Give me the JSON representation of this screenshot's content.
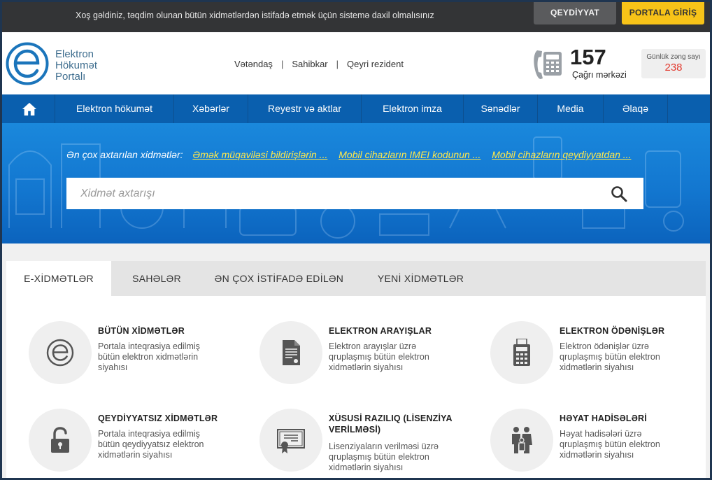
{
  "topbar": {
    "message": "Xoş gəldiniz, təqdim olunan bütün xidmətlərdən istifadə etmək üçün sistemə daxil olmalısınız",
    "register_label": "QEYDİYYAT",
    "login_label": "PORTALA GİRİŞ"
  },
  "logo": {
    "line1": "Elektron",
    "line2": "Hökumət",
    "line3": "Portalı"
  },
  "user_nav": [
    "Vətəndaş",
    "Sahibkar",
    "Qeyri rezident"
  ],
  "call_center": {
    "number": "157",
    "label": "Çağrı mərkəzi",
    "daily_label": "Günlük zəng sayı",
    "daily_value": "238"
  },
  "main_nav": [
    "Elektron hökumət",
    "Xəbərlər",
    "Reyestr və aktlar",
    "Elektron imza",
    "Sənədlər",
    "Media",
    "Əlaqə"
  ],
  "hero": {
    "popular_label": "Ən çox axtarılan xidmətlər:",
    "popular_links": [
      "Əmək müqaviləsi bildirişlərin ...",
      "Mobil cihazların IMEI kodunun ...",
      "Mobil cihazların qeydiyyatdan ..."
    ],
    "search_placeholder": "Xidmət axtarışı"
  },
  "tabs": [
    "E-XİDMƏTLƏR",
    "SAHƏLƏR",
    "ƏN ÇOX İSTİFADƏ EDİLƏN",
    "YENİ XİDMƏTLƏR"
  ],
  "services": [
    {
      "title": "BÜTÜN XİDMƏTLƏR",
      "desc": "Portala inteqrasiya edilmiş bütün elektron xidmətlərin siyahısı",
      "icon": "egov-logo-icon"
    },
    {
      "title": "ELEKTRON ARAYIŞLAR",
      "desc": "Elektron arayışlar üzrə qruplaşmış bütün elektron xidmətlərin siyahısı",
      "icon": "document-icon"
    },
    {
      "title": "ELEKTRON ÖDƏNİŞLƏR",
      "desc": "Elektron ödənişlər üzrə qruplaşmış bütün elektron xidmətlərin siyahısı",
      "icon": "calculator-icon"
    },
    {
      "title": "QEYDİYYATSIZ XİDMƏTLƏR",
      "desc": "Portala inteqrasiya edilmiş bütün qeydiyyatsız elektron xidmətlərin siyahısı",
      "icon": "unlock-icon"
    },
    {
      "title": "XÜSUSİ RAZILIQ (LİSENZİYA VERİLMƏSİ)",
      "desc": "Lisenziyaların verilməsi üzrə qruplaşmış bütün elektron xidmətlərin siyahısı",
      "icon": "certificate-icon"
    },
    {
      "title": "HƏYAT HADİSƏLƏRİ",
      "desc": "Həyat hadisələri üzrə qruplaşmış bütün elektron xidmətlərin siyahısı",
      "icon": "family-icon"
    }
  ],
  "colors": {
    "nav_blue": "#0a5fae",
    "hero_blue": "#1377d0",
    "accent_yellow": "#f7c318",
    "link_yellow": "#ffe84a",
    "daily_red": "#e23b30"
  }
}
